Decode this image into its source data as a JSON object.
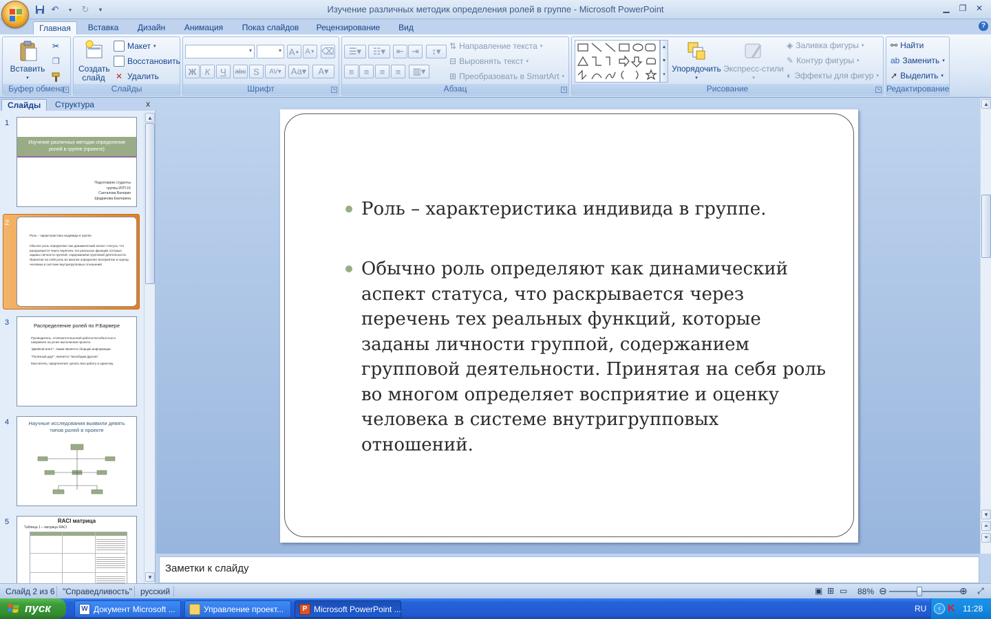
{
  "window": {
    "title": "Изучение различных методик определения ролей в группе  -  Microsoft PowerPoint",
    "controls": [
      "minimize",
      "restore",
      "close"
    ]
  },
  "ribbon_tabs": [
    {
      "label": "Главная",
      "active": true
    },
    {
      "label": "Вставка"
    },
    {
      "label": "Дизайн"
    },
    {
      "label": "Анимация"
    },
    {
      "label": "Показ слайдов"
    },
    {
      "label": "Рецензирование"
    },
    {
      "label": "Вид"
    }
  ],
  "groups": {
    "clipboard": {
      "label": "Буфер обмена",
      "paste": "Вставить"
    },
    "slides": {
      "label": "Слайды",
      "new_slide": "Создать слайд",
      "layout": "Макет",
      "reset": "Восстановить",
      "delete": "Удалить"
    },
    "font": {
      "label": "Шрифт"
    },
    "paragraph": {
      "label": "Абзац",
      "text_direction": "Направление текста",
      "align_text": "Выровнять текст",
      "smartart": "Преобразовать в SmartArt"
    },
    "drawing": {
      "label": "Рисование",
      "arrange": "Упорядочить",
      "quick_styles": "Экспресс-стили",
      "shape_fill": "Заливка фигуры",
      "shape_outline": "Контур фигуры",
      "shape_effects": "Эффекты для фигур"
    },
    "editing": {
      "label": "Редактирование",
      "find": "Найти",
      "replace": "Заменить",
      "select": "Выделить"
    }
  },
  "panel": {
    "tabs": [
      "Слайды",
      "Структура"
    ],
    "close": "x",
    "thumbnails": [
      {
        "num": "1",
        "title": "Изучение различных методик определения ролей в группе (проекте)",
        "lines": [
          "Подготовили студенты",
          "группы ИУП-15",
          "Санталова Валерия",
          "Щедринова Екатерина"
        ]
      },
      {
        "num": "2",
        "lines": [
          "Роль – характеристика индивида в группе.",
          "Обычно роль определяют как динамический аспект статуса, что раскрывается через перечень тех реальных функций, которые заданы личности группой, содержанием групповой деятельности. Принятая на себя роль во многом определяет восприятие и оценку человека в системе внутригрупповых отношений."
        ]
      },
      {
        "num": "3",
        "title": "Распределение ролей по Р.Барвере",
        "lines": [
          "Руководитель, отличается высокой работоспособностью и направлен на успех выполнения проекта.",
          "\"Двойной агент\", таким является сборщик информации.",
          "\"Полезный друг\", является \"всеобщим другом\".",
          "Мыслитель, предпочитает делать всю работу в одиночку."
        ]
      },
      {
        "num": "4",
        "title": "Научные исследования выявили девять типов ролей в проекте"
      },
      {
        "num": "5",
        "title": "RACI матрица",
        "lines": [
          "Таблица 1 – матрица RACI"
        ]
      }
    ]
  },
  "slide": {
    "bullets": [
      "Роль – характеристика индивида в группе.",
      "Обычно роль определяют как динамический аспект статуса, что раскрывается через перечень тех реальных функций, которые заданы личности группой, содержанием групповой деятельности. Принятая на себя роль во многом определяет восприятие и оценку человека в системе внутригрупповых отношений."
    ],
    "bullet_lines": [
      [
        "Роль – характеристика индивида в группе."
      ],
      [
        "Обычно роль определяют как динамический",
        "аспект статуса, что раскрывается через",
        "перечень тех реальных функций, которые",
        "заданы личности группой, содержанием",
        "групповой деятельности. Принятая на себя роль",
        "во многом определяет восприятие и оценку",
        "человека в системе внутригрупповых",
        "отношений."
      ]
    ],
    "bullet_color": "#9aac86"
  },
  "notes": {
    "placeholder": "Заметки к слайду"
  },
  "status": {
    "slide": "Слайд 2 из 6",
    "theme": "\"Справедливость\"",
    "language": "русский",
    "zoom": "88%"
  },
  "taskbar": {
    "start": "пуск",
    "tasks": [
      {
        "label": "Документ Microsoft ...",
        "active": false
      },
      {
        "label": "Управление проект...",
        "active": false
      },
      {
        "label": "Microsoft PowerPoint ...",
        "active": true
      }
    ],
    "lang": "RU",
    "clock": "11:28"
  }
}
